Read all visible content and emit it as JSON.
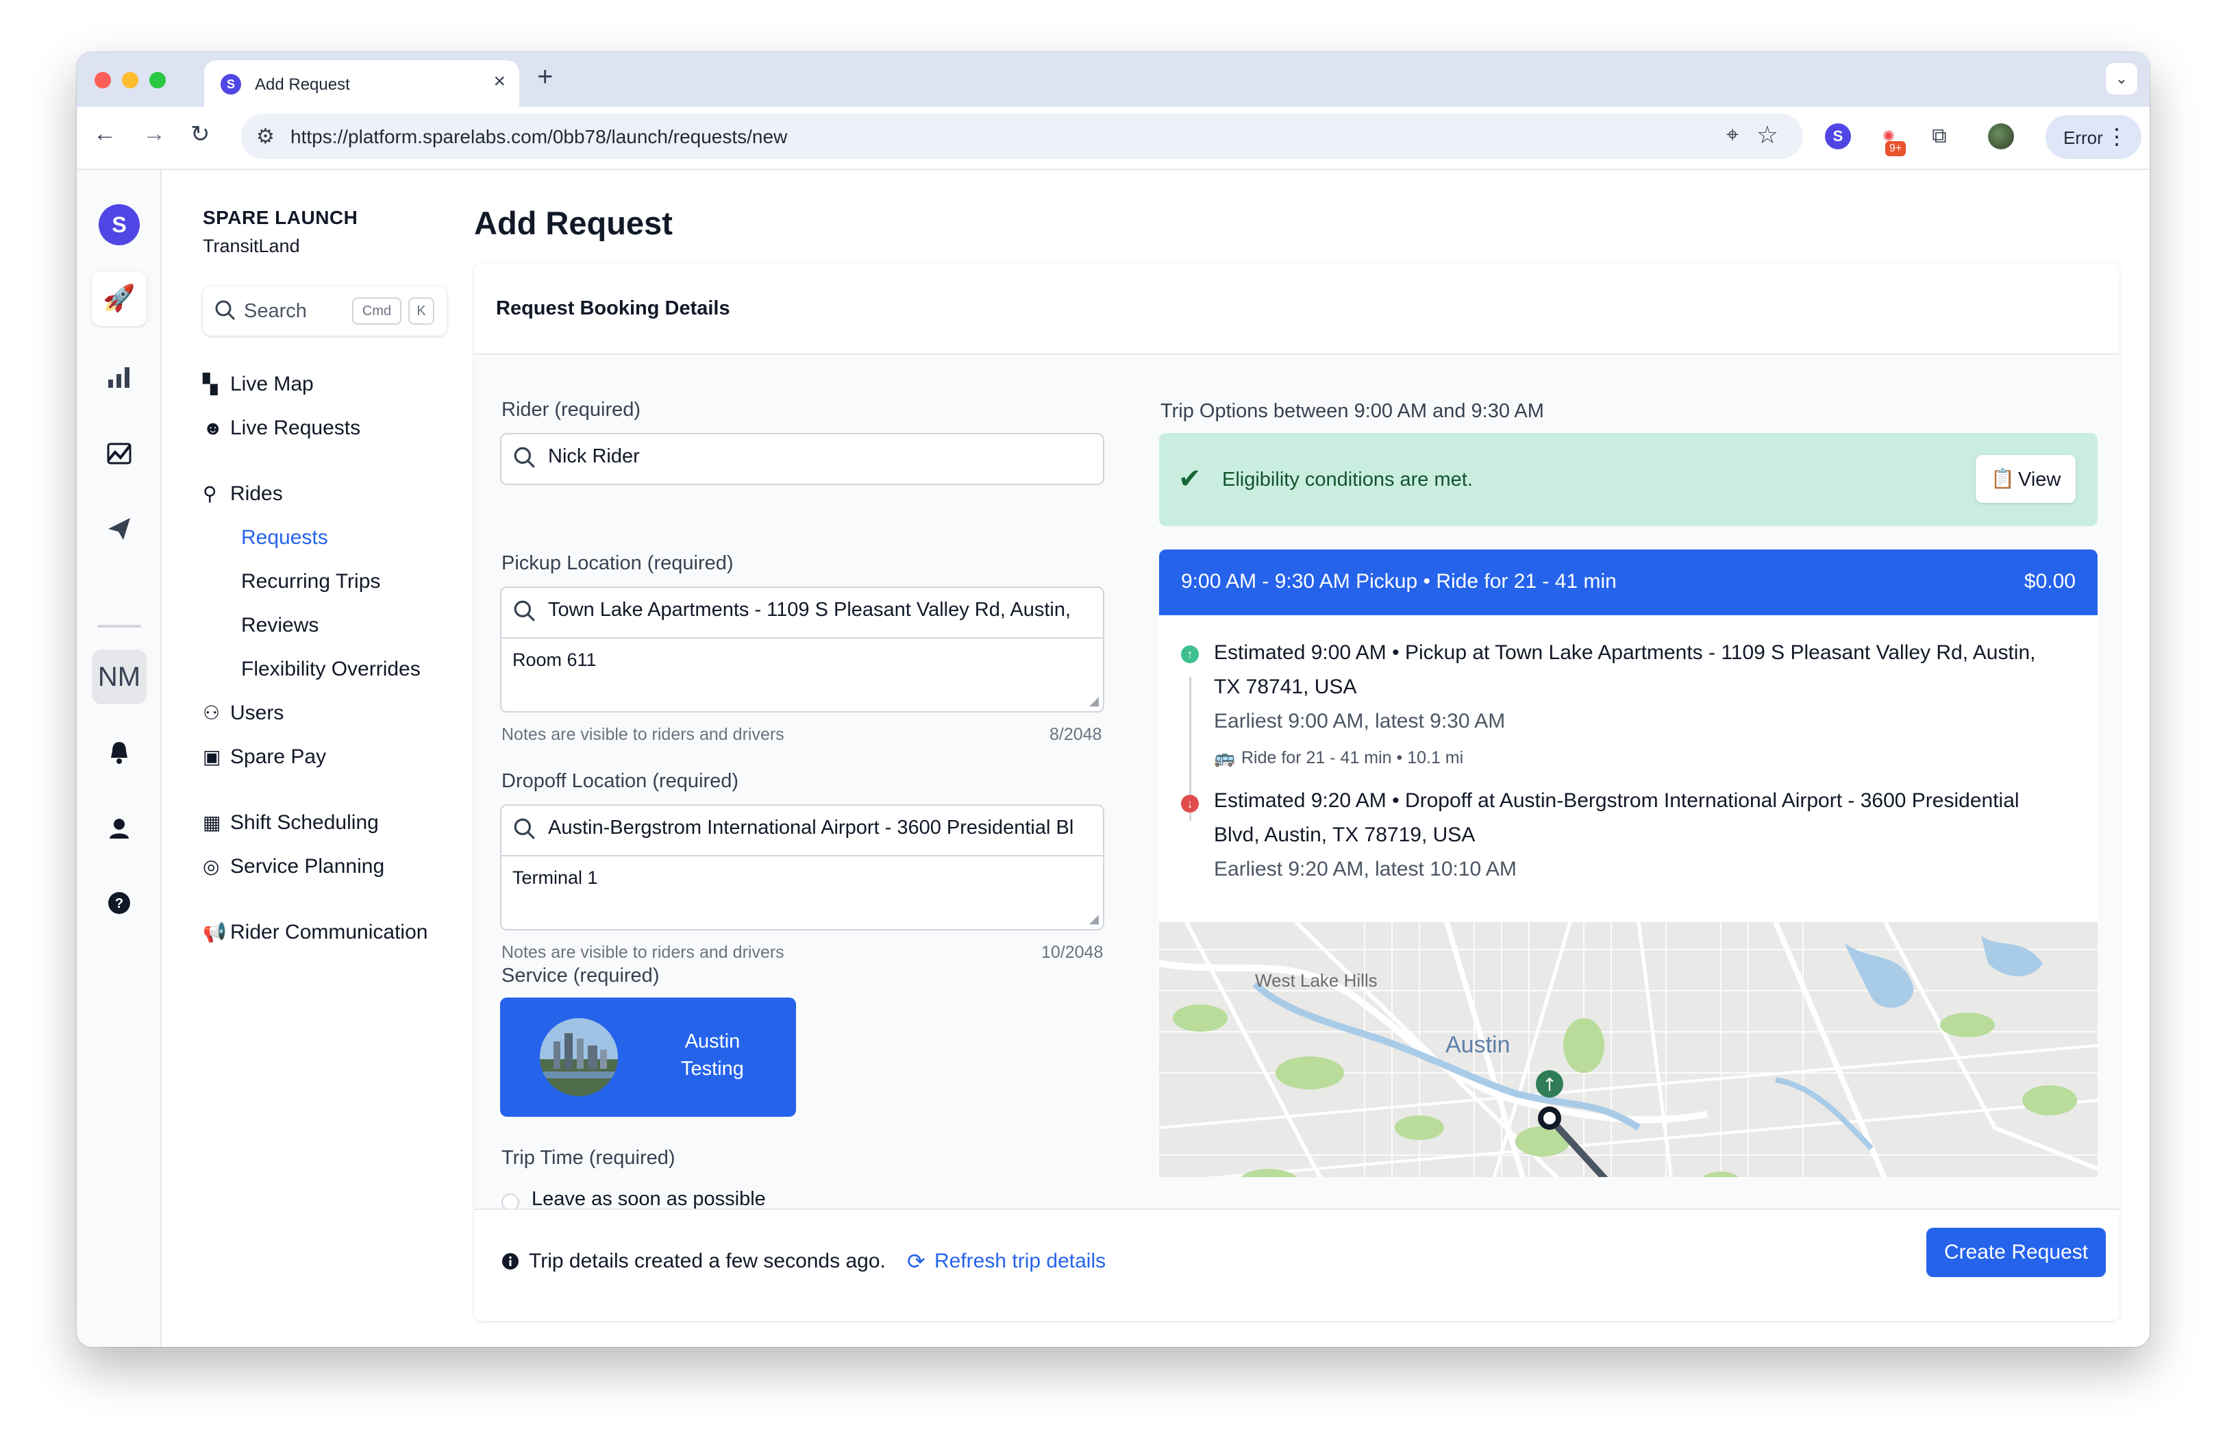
{
  "browser": {
    "tab_title": "Add Request",
    "tab_favicon": "S",
    "url": "https://platform.sparelabs.com/0bb78/launch/requests/new",
    "profile_button": "Error",
    "extension_badge": "9+"
  },
  "rail": {
    "logo": "S",
    "workspace_initials": "NM"
  },
  "sidebar": {
    "org_name": "SPARE LAUNCH",
    "org_sub": "TransitLand",
    "search_placeholder": "Search",
    "search_kbd_1": "Cmd",
    "search_kbd_2": "K",
    "items": {
      "live_map": "Live Map",
      "live_requests": "Live Requests",
      "rides": "Rides",
      "requests": "Requests",
      "recurring_trips": "Recurring Trips",
      "reviews": "Reviews",
      "flexibility_overrides": "Flexibility Overrides",
      "users": "Users",
      "spare_pay": "Spare Pay",
      "shift_scheduling": "Shift Scheduling",
      "service_planning": "Service Planning",
      "rider_communication": "Rider Communication"
    }
  },
  "main": {
    "page_title": "Add Request",
    "card_title": "Request Booking Details",
    "rider_label": "Rider (required)",
    "rider_value": "Nick Rider",
    "pickup_label": "Pickup Location (required)",
    "pickup_value": "Town Lake Apartments - 1109 S Pleasant Valley Rd, Austin,",
    "pickup_note": "Room 611",
    "pickup_hint": "Notes are visible to riders and drivers",
    "pickup_count": "8/2048",
    "dropoff_label": "Dropoff Location (required)",
    "dropoff_value": "Austin-Bergstrom International Airport - 3600 Presidential Bl",
    "dropoff_note": "Terminal 1",
    "dropoff_hint": "Notes are visible to riders and drivers",
    "dropoff_count": "10/2048",
    "service_label": "Service (required)",
    "service_name": "Austin Testing",
    "trip_time_label": "Trip Time (required)",
    "trip_time_option": "Leave as soon as possible"
  },
  "trip": {
    "options_label": "Trip Options between 9:00 AM and 9:30 AM",
    "eligibility": "Eligibility conditions are met.",
    "view_button": "View",
    "header_left": "9:00 AM - 9:30 AM Pickup • Ride for 21 - 41 min",
    "header_right": "$0.00",
    "pickup_main": "Estimated 9:00 AM • Pickup at Town Lake Apartments - 1109 S Pleasant Valley Rd, Austin, TX 78741, USA",
    "pickup_window": "Earliest 9:00 AM, latest 9:30 AM",
    "ride_info": "Ride for 21 - 41 min • 10.1 mi",
    "dropoff_main": "Estimated 9:20 AM • Dropoff at Austin-Bergstrom International Airport - 3600 Presidential Blvd, Austin, TX 78719, USA",
    "dropoff_window": "Earliest 9:20 AM, latest 10:10 AM",
    "map_label_city": "Austin",
    "map_label_area": "West Lake Hills"
  },
  "footer": {
    "info": "Trip details created a few seconds ago.",
    "refresh": "Refresh trip details",
    "create_button": "Create Request"
  },
  "colors": {
    "accent": "#2563eb",
    "brand": "#4f46e5",
    "eligibility_bg": "#c9eee0",
    "pickup_marker": "#3fbf8f",
    "dropoff_marker": "#e04b4b"
  }
}
